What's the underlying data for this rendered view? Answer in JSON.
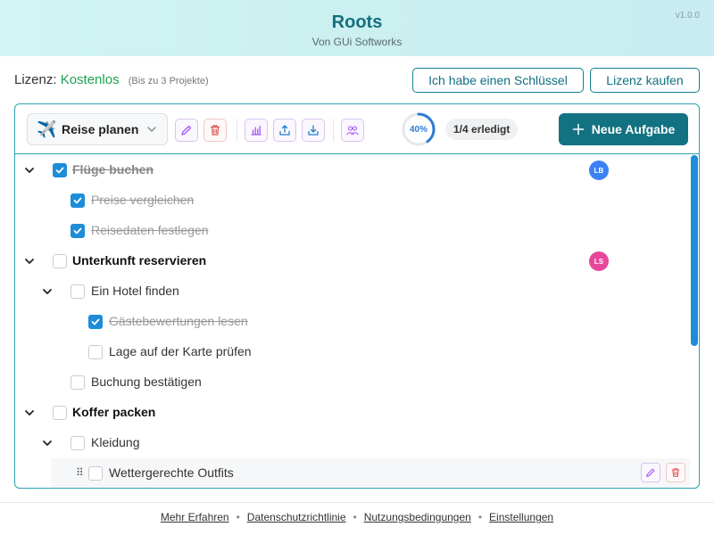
{
  "app": {
    "title": "Roots",
    "subtitle": "Von GUi Softworks",
    "version": "v1.0.0"
  },
  "license": {
    "label": "Lizenz:",
    "value": "Kostenlos",
    "hint": "(Bis zu 3 Projekte)",
    "key_button": "Ich habe einen Schlüssel",
    "buy_button": "Lizenz kaufen"
  },
  "toolbar": {
    "project_name": "Reise planen",
    "project_icon": "airplane-icon",
    "progress": "40%",
    "progress_value": 0.4,
    "done_label": "1/4 erledigt",
    "new_task_button": "Neue Aufgabe"
  },
  "tasks": [
    {
      "label": "Flüge buchen",
      "level": 0,
      "checked": true,
      "expanded": true,
      "bold": true,
      "avatar": "LB",
      "avatar_color": "#3b82f6"
    },
    {
      "label": "Preise vergleichen",
      "level": 1,
      "checked": true
    },
    {
      "label": "Reisedaten festlegen",
      "level": 1,
      "checked": true
    },
    {
      "label": "Unterkunft reservieren",
      "level": 0,
      "checked": false,
      "expanded": true,
      "bold": true,
      "avatar": "LS",
      "avatar_color": "#e8479b"
    },
    {
      "label": "Ein Hotel finden",
      "level": 1,
      "checked": false,
      "expanded": true
    },
    {
      "label": "Gästebewertungen lesen",
      "level": 2,
      "checked": true
    },
    {
      "label": "Lage auf der Karte prüfen",
      "level": 2,
      "checked": false
    },
    {
      "label": "Buchung bestätigen",
      "level": 1,
      "checked": false
    },
    {
      "label": "Koffer packen",
      "level": 0,
      "checked": false,
      "expanded": true,
      "bold": true
    },
    {
      "label": "Kleidung",
      "level": 1,
      "checked": false,
      "expanded": true
    },
    {
      "label": "Wettergerechte Outfits",
      "level": 2,
      "checked": false,
      "hover": true
    }
  ],
  "footer": {
    "links": [
      "Mehr Erfahren",
      "Datenschutzrichtlinie",
      "Nutzungsbedingungen",
      "Einstellungen"
    ]
  },
  "colors": {
    "accent": "#137282",
    "check": "#1d8cd9",
    "license_value": "#1ea152"
  }
}
